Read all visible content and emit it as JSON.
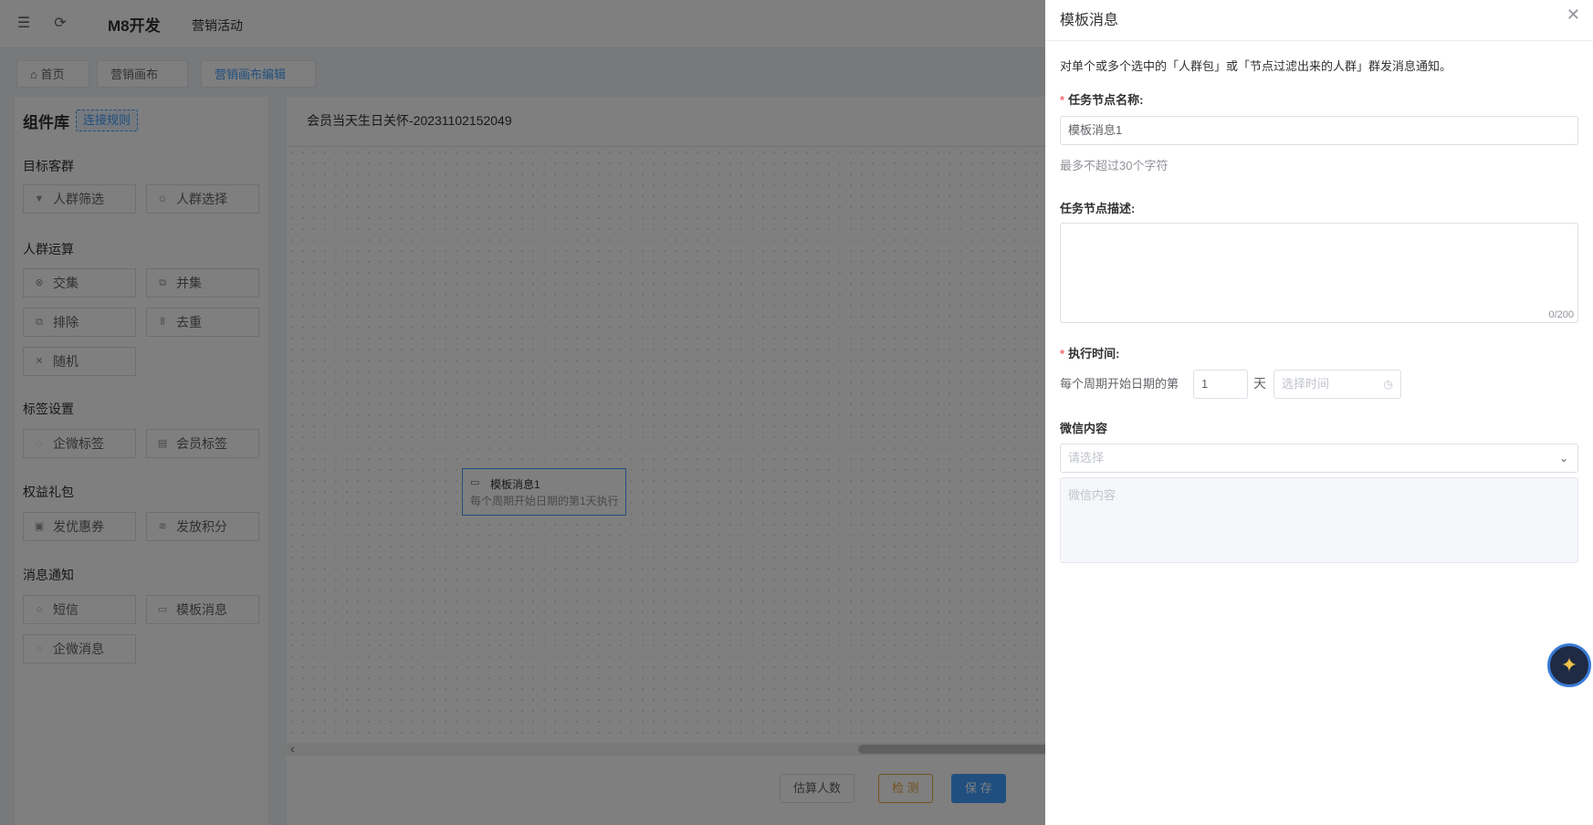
{
  "topbar": {
    "brand": "M8开发",
    "menu": "营销活动"
  },
  "tabs": [
    {
      "label": "首页"
    },
    {
      "label": "营销画布"
    },
    {
      "label": "营销画布编辑"
    }
  ],
  "sidebar": {
    "title": "组件库",
    "link_rule": "连接规则",
    "groups": {
      "target": "目标客群",
      "ops": "人群运算",
      "tags": "标签设置",
      "gifts": "权益礼包",
      "msg": "消息通知"
    },
    "items": {
      "crowd_filter": "人群筛选",
      "crowd_select": "人群选择",
      "intersect": "交集",
      "union": "并集",
      "exclude": "排除",
      "dedupe": "去重",
      "random": "随机",
      "wework_tag": "企微标签",
      "member_tag": "会员标签",
      "coupon": "发优惠券",
      "points": "发放积分",
      "sms": "短信",
      "template_msg": "模板消息",
      "wework_msg": "企微消息"
    }
  },
  "canvas": {
    "title": "会员当天生日关怀-20231102152049",
    "node": {
      "title": "模板消息1",
      "desc": "每个周期开始日期的第1天执行"
    },
    "buttons": {
      "estimate": "估算人数",
      "check": "检 测",
      "save": "保 存"
    }
  },
  "drawer": {
    "title": "模板消息",
    "intro": "对单个或多个选中的「人群包」或「节点过滤出来的人群」群发消息通知。",
    "name_label": "任务节点名称:",
    "name_value": "模板消息1",
    "name_hint": "最多不超过30个字符",
    "desc_label": "任务节点描述:",
    "desc_count": "0/200",
    "exec_label": "执行时间:",
    "exec_prefix": "每个周期开始日期的第",
    "exec_day_value": "1",
    "exec_day_unit": "天",
    "time_placeholder": "选择时间",
    "wechat_label": "微信内容",
    "select_placeholder": "请选择",
    "wechat_placeholder": "微信内容"
  }
}
